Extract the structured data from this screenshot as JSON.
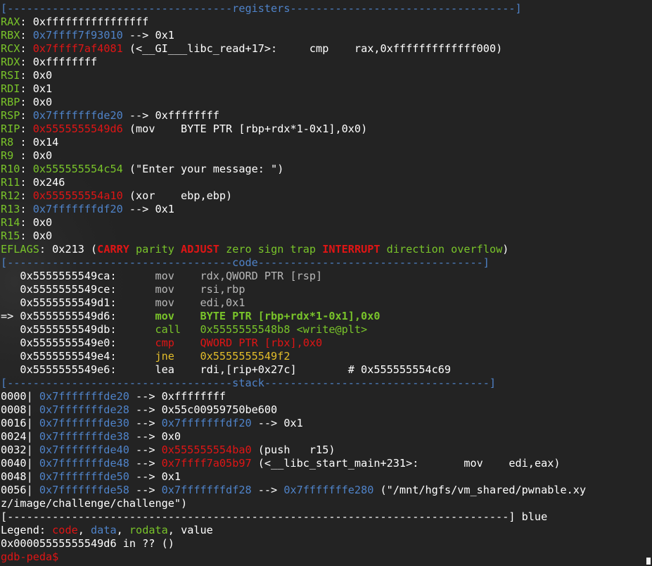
{
  "terminal": {
    "lines": [
      [
        {
          "t": "[-----------------------------------",
          "c": "b"
        },
        {
          "t": "registers",
          "c": "b"
        },
        {
          "t": "-----------------------------------]",
          "c": "b"
        }
      ],
      [
        {
          "t": "RAX",
          "c": "g"
        },
        {
          "t": ": 0xffffffffffffffff",
          "c": "w"
        }
      ],
      [
        {
          "t": "RBX",
          "c": "g"
        },
        {
          "t": ": ",
          "c": "w"
        },
        {
          "t": "0x7ffff7f93010",
          "c": "b"
        },
        {
          "t": " --> 0x1",
          "c": "w"
        }
      ],
      [
        {
          "t": "RCX",
          "c": "g"
        },
        {
          "t": ": ",
          "c": "w"
        },
        {
          "t": "0x7ffff7af4081",
          "c": "r"
        },
        {
          "t": " (<__GI___libc_read+17>:     cmp    rax,0xfffffffffffff000)",
          "c": "w"
        }
      ],
      [
        {
          "t": "RDX",
          "c": "g"
        },
        {
          "t": ": 0xffffffff",
          "c": "w"
        }
      ],
      [
        {
          "t": "RSI",
          "c": "g"
        },
        {
          "t": ": 0x0",
          "c": "w"
        }
      ],
      [
        {
          "t": "RDI",
          "c": "g"
        },
        {
          "t": ": 0x1",
          "c": "w"
        }
      ],
      [
        {
          "t": "RBP",
          "c": "g"
        },
        {
          "t": ": 0x0",
          "c": "w"
        }
      ],
      [
        {
          "t": "RSP",
          "c": "g"
        },
        {
          "t": ": ",
          "c": "w"
        },
        {
          "t": "0x7fffffffde20",
          "c": "b"
        },
        {
          "t": " --> 0xffffffff",
          "c": "w"
        }
      ],
      [
        {
          "t": "RIP",
          "c": "g"
        },
        {
          "t": ": ",
          "c": "w"
        },
        {
          "t": "0x5555555549d6",
          "c": "r"
        },
        {
          "t": " (mov    BYTE PTR [rbp+rdx*1-0x1],0x0)",
          "c": "w"
        }
      ],
      [
        {
          "t": "R8 ",
          "c": "g"
        },
        {
          "t": ": 0x14",
          "c": "w"
        }
      ],
      [
        {
          "t": "R9 ",
          "c": "g"
        },
        {
          "t": ": 0x0",
          "c": "w"
        }
      ],
      [
        {
          "t": "R10",
          "c": "g"
        },
        {
          "t": ": ",
          "c": "w"
        },
        {
          "t": "0x555555554c54",
          "c": "g"
        },
        {
          "t": " (\"Enter your message: \")",
          "c": "w"
        }
      ],
      [
        {
          "t": "R11",
          "c": "g"
        },
        {
          "t": ": 0x246",
          "c": "w"
        }
      ],
      [
        {
          "t": "R12",
          "c": "g"
        },
        {
          "t": ": ",
          "c": "w"
        },
        {
          "t": "0x555555554a10",
          "c": "r"
        },
        {
          "t": " (xor    ebp,ebp)",
          "c": "w"
        }
      ],
      [
        {
          "t": "R13",
          "c": "g"
        },
        {
          "t": ": ",
          "c": "w"
        },
        {
          "t": "0x7fffffffdf20",
          "c": "b"
        },
        {
          "t": " --> 0x1",
          "c": "w"
        }
      ],
      [
        {
          "t": "R14",
          "c": "g"
        },
        {
          "t": ": 0x0",
          "c": "w"
        }
      ],
      [
        {
          "t": "R15",
          "c": "g"
        },
        {
          "t": ": 0x0",
          "c": "w"
        }
      ],
      [
        {
          "t": "EFLAGS",
          "c": "g"
        },
        {
          "t": ": 0x213 (",
          "c": "w"
        },
        {
          "t": "CARRY",
          "c": "r bold"
        },
        {
          "t": " parity ",
          "c": "g"
        },
        {
          "t": "ADJUST",
          "c": "r bold"
        },
        {
          "t": " zero sign trap ",
          "c": "g"
        },
        {
          "t": "INTERRUPT",
          "c": "r bold"
        },
        {
          "t": " direction overflow",
          "c": "g"
        },
        {
          "t": ")",
          "c": "w"
        }
      ],
      [
        {
          "t": "[-----------------------------------",
          "c": "b"
        },
        {
          "t": "code",
          "c": "b"
        },
        {
          "t": "-----------------------------------]",
          "c": "b"
        }
      ],
      [
        {
          "t": "   0x5555555549ca:      ",
          "c": "w"
        },
        {
          "t": "mov    rdx,QWORD PTR [rsp]",
          "c": "c"
        }
      ],
      [
        {
          "t": "   0x5555555549ce:      ",
          "c": "w"
        },
        {
          "t": "mov    rsi,rbp",
          "c": "c"
        }
      ],
      [
        {
          "t": "   0x5555555549d1:      ",
          "c": "w"
        },
        {
          "t": "mov    edi,0x1",
          "c": "c"
        }
      ],
      [
        {
          "t": "=> 0x5555555549d6:      ",
          "c": "w"
        },
        {
          "t": "mov    BYTE PTR [rbp+rdx*1-0x1],0x0",
          "c": "g bold"
        }
      ],
      [
        {
          "t": "   0x5555555549db:      ",
          "c": "w"
        },
        {
          "t": "call   0x5555555548b8 <write@plt>",
          "c": "g"
        }
      ],
      [
        {
          "t": "   0x5555555549e0:      ",
          "c": "w"
        },
        {
          "t": "cmp    QWORD PTR [rbx],0x0",
          "c": "r"
        }
      ],
      [
        {
          "t": "   0x5555555549e4:      ",
          "c": "w"
        },
        {
          "t": "jne    0x5555555549f2",
          "c": "y"
        }
      ],
      [
        {
          "t": "   0x5555555549e6:      lea    rdi,[rip+0x27c]        # 0x555555554c69",
          "c": "w"
        }
      ],
      [
        {
          "t": "[-----------------------------------",
          "c": "b"
        },
        {
          "t": "stack",
          "c": "b"
        },
        {
          "t": "-----------------------------------]",
          "c": "b"
        }
      ],
      [
        {
          "t": "0000| ",
          "c": "w"
        },
        {
          "t": "0x7fffffffde20",
          "c": "b"
        },
        {
          "t": " --> 0xffffffff",
          "c": "w"
        }
      ],
      [
        {
          "t": "0008| ",
          "c": "w"
        },
        {
          "t": "0x7fffffffde28",
          "c": "b"
        },
        {
          "t": " --> 0x55c00959750be600",
          "c": "w"
        }
      ],
      [
        {
          "t": "0016| ",
          "c": "w"
        },
        {
          "t": "0x7fffffffde30",
          "c": "b"
        },
        {
          "t": " --> ",
          "c": "w"
        },
        {
          "t": "0x7fffffffdf20",
          "c": "b"
        },
        {
          "t": " --> 0x1",
          "c": "w"
        }
      ],
      [
        {
          "t": "0024| ",
          "c": "w"
        },
        {
          "t": "0x7fffffffde38",
          "c": "b"
        },
        {
          "t": " --> 0x0",
          "c": "w"
        }
      ],
      [
        {
          "t": "0032| ",
          "c": "w"
        },
        {
          "t": "0x7fffffffde40",
          "c": "b"
        },
        {
          "t": " --> ",
          "c": "w"
        },
        {
          "t": "0x555555554ba0",
          "c": "r"
        },
        {
          "t": " (push   r15)",
          "c": "w"
        }
      ],
      [
        {
          "t": "0040| ",
          "c": "w"
        },
        {
          "t": "0x7fffffffde48",
          "c": "b"
        },
        {
          "t": " --> ",
          "c": "w"
        },
        {
          "t": "0x7ffff7a05b97",
          "c": "r"
        },
        {
          "t": " (<__libc_start_main+231>:       mov    edi,eax)",
          "c": "w"
        }
      ],
      [
        {
          "t": "0048| ",
          "c": "w"
        },
        {
          "t": "0x7fffffffde50",
          "c": "b"
        },
        {
          "t": " --> 0x1",
          "c": "w"
        }
      ],
      [
        {
          "t": "0056| ",
          "c": "w"
        },
        {
          "t": "0x7fffffffde58",
          "c": "b"
        },
        {
          "t": " --> ",
          "c": "w"
        },
        {
          "t": "0x7fffffffdf28",
          "c": "b"
        },
        {
          "t": " --> ",
          "c": "w"
        },
        {
          "t": "0x7fffffffe280",
          "c": "b"
        },
        {
          "t": " (\"/mnt/hgfs/vm_shared/pwnable.xy",
          "c": "w"
        }
      ],
      [
        {
          "t": "z/image/challenge/challenge\")",
          "c": "w"
        }
      ],
      [
        {
          "t": "[------------------------------------------------------------------------------] blue",
          "c": "w"
        }
      ],
      [
        {
          "t": "Legend: ",
          "c": "w"
        },
        {
          "t": "code",
          "c": "r"
        },
        {
          "t": ", ",
          "c": "w"
        },
        {
          "t": "data",
          "c": "b"
        },
        {
          "t": ", ",
          "c": "w"
        },
        {
          "t": "rodata",
          "c": "g"
        },
        {
          "t": ", value",
          "c": "w"
        }
      ],
      [
        {
          "t": "0x00005555555549d6 in ?? ()",
          "c": "w"
        }
      ],
      [
        {
          "t": "gdb-peda$",
          "c": "r"
        }
      ]
    ]
  },
  "colors": {
    "background": "#232323",
    "blue": "#4f83c9",
    "red": "#e01515",
    "green": "#79c42a",
    "yellow": "#e3bd2a",
    "grey": "#b8b8b8",
    "white": "#ffffff"
  }
}
